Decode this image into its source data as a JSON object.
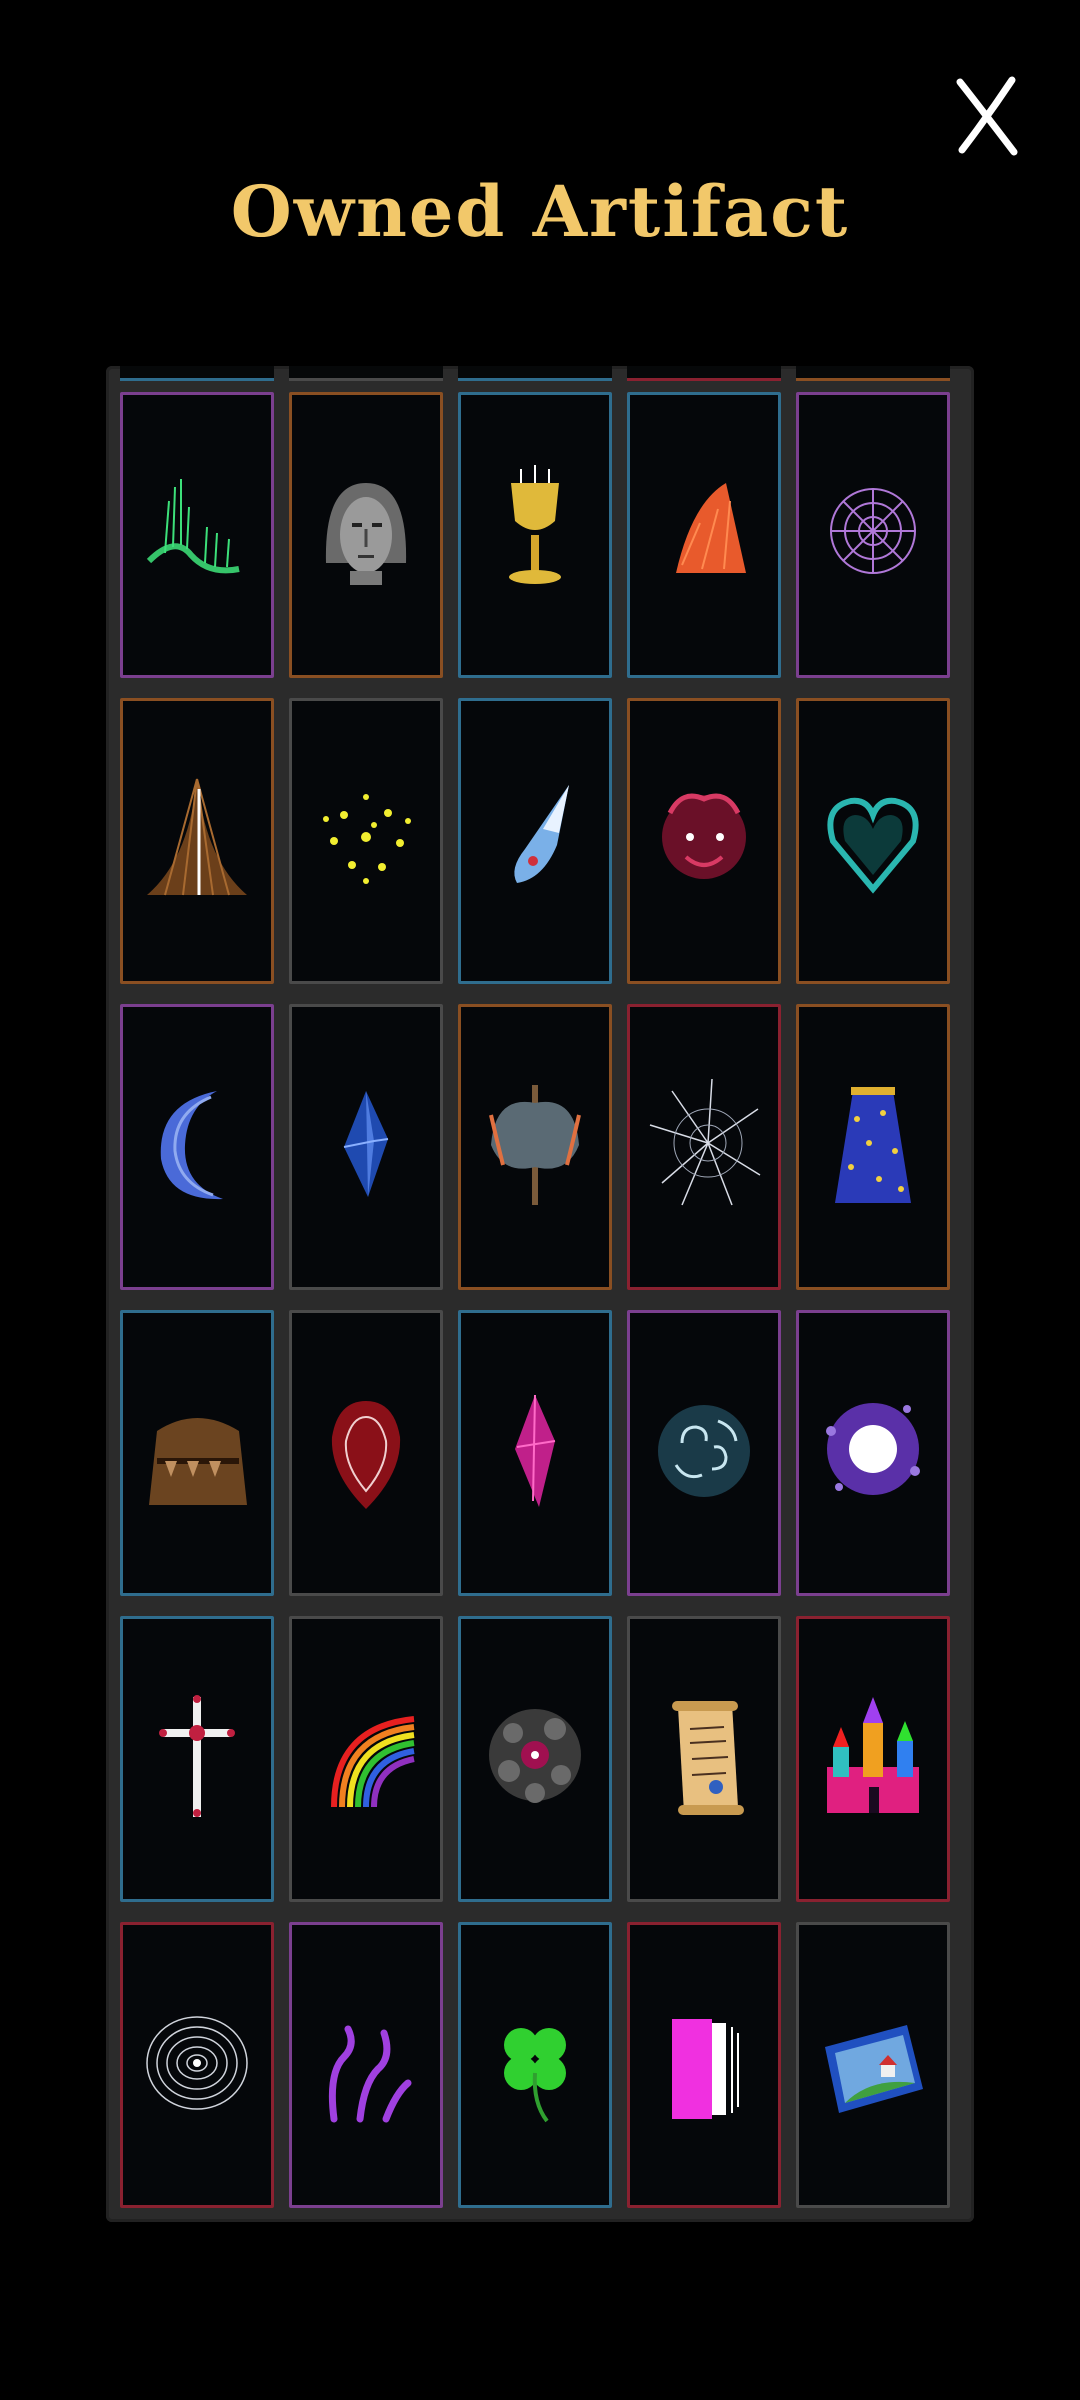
{
  "header": {
    "title": "Owned Artifact",
    "close_icon": "close-icon"
  },
  "colors": {
    "background": "#000000",
    "title": "#f2c86a",
    "frame": "#2b2b2b",
    "rarity_blue": "#2f6d8e",
    "rarity_orange": "#8a4f22",
    "rarity_purple": "#7b3f8f",
    "rarity_red": "#8a2130",
    "rarity_gray": "#4a4a4a"
  },
  "artifacts": [
    {
      "icon": "aurora-icon",
      "rarity": "purple"
    },
    {
      "icon": "stone-mask-icon",
      "rarity": "orange"
    },
    {
      "icon": "golden-chalice-icon",
      "rarity": "blue"
    },
    {
      "icon": "red-fur-icon",
      "rarity": "blue"
    },
    {
      "icon": "spider-web-icon",
      "rarity": "purple"
    },
    {
      "icon": "tent-icon",
      "rarity": "orange"
    },
    {
      "icon": "yellow-sparks-icon",
      "rarity": "gray"
    },
    {
      "icon": "crystal-fang-icon",
      "rarity": "blue"
    },
    {
      "icon": "jester-face-icon",
      "rarity": "orange"
    },
    {
      "icon": "thorny-heart-icon",
      "rarity": "orange"
    },
    {
      "icon": "crescent-moon-icon",
      "rarity": "purple"
    },
    {
      "icon": "blue-crystal-icon",
      "rarity": "gray"
    },
    {
      "icon": "double-axe-icon",
      "rarity": "orange"
    },
    {
      "icon": "shattered-glass-icon",
      "rarity": "red"
    },
    {
      "icon": "starry-cloak-icon",
      "rarity": "orange"
    },
    {
      "icon": "wooden-mimic-icon",
      "rarity": "blue"
    },
    {
      "icon": "red-seed-icon",
      "rarity": "gray"
    },
    {
      "icon": "pink-crystal-icon",
      "rarity": "blue"
    },
    {
      "icon": "swirl-orb-icon",
      "rarity": "purple"
    },
    {
      "icon": "purple-portal-icon",
      "rarity": "purple"
    },
    {
      "icon": "holy-cross-icon",
      "rarity": "blue"
    },
    {
      "icon": "rainbow-icon",
      "rarity": "gray"
    },
    {
      "icon": "dark-cluster-icon",
      "rarity": "blue"
    },
    {
      "icon": "scroll-icon",
      "rarity": "gray"
    },
    {
      "icon": "dream-castle-icon",
      "rarity": "red"
    },
    {
      "icon": "vortex-icon",
      "rarity": "red"
    },
    {
      "icon": "purple-tentacles-icon",
      "rarity": "purple"
    },
    {
      "icon": "four-leaf-clover-icon",
      "rarity": "blue"
    },
    {
      "icon": "glitch-block-icon",
      "rarity": "red"
    },
    {
      "icon": "painting-icon",
      "rarity": "gray"
    }
  ]
}
